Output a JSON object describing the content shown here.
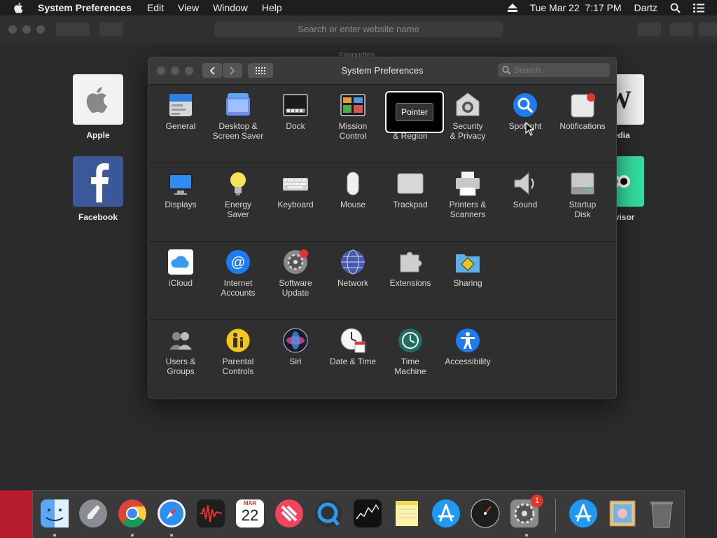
{
  "menubar": {
    "app_name": "System Preferences",
    "menus": [
      "Edit",
      "View",
      "Window",
      "Help"
    ],
    "datetime": "Tue Mar 22  7:17 PM",
    "user": "Dartz"
  },
  "safari": {
    "address_placeholder": "Search or enter website name",
    "faded_heading": "Favourites",
    "favourites": [
      {
        "label": "Apple"
      },
      {
        "label": "Facebook"
      },
      {
        "label": "pedia"
      },
      {
        "label": "Advisor"
      }
    ]
  },
  "prefs": {
    "title": "System Preferences",
    "search_placeholder": "Search",
    "sections": [
      [
        {
          "label": "General",
          "icon": "general-icon"
        },
        {
          "label": "Desktop &\nScreen Saver",
          "icon": "desktop-icon"
        },
        {
          "label": "Dock",
          "icon": "dock-icon"
        },
        {
          "label": "Mission\nControl",
          "icon": "mission-control-icon"
        },
        {
          "label": "Language\n& Region",
          "icon": "language-icon"
        },
        {
          "label": "Security\n& Privacy",
          "icon": "security-icon"
        },
        {
          "label": "Spotlight",
          "icon": "spotlight-icon"
        },
        {
          "label": "Notifications",
          "icon": "notifications-icon"
        }
      ],
      [
        {
          "label": "Displays",
          "icon": "displays-icon"
        },
        {
          "label": "Energy\nSaver",
          "icon": "energy-icon"
        },
        {
          "label": "Keyboard",
          "icon": "keyboard-icon"
        },
        {
          "label": "Mouse",
          "icon": "mouse-icon"
        },
        {
          "label": "Trackpad",
          "icon": "trackpad-icon"
        },
        {
          "label": "Printers &\nScanners",
          "icon": "printer-icon"
        },
        {
          "label": "Sound",
          "icon": "sound-icon"
        },
        {
          "label": "Startup\nDisk",
          "icon": "startup-disk-icon"
        }
      ],
      [
        {
          "label": "iCloud",
          "icon": "icloud-icon"
        },
        {
          "label": "Internet\nAccounts",
          "icon": "internet-accounts-icon"
        },
        {
          "label": "Software\nUpdate",
          "icon": "software-update-icon",
          "badge": "1"
        },
        {
          "label": "Network",
          "icon": "network-icon"
        },
        {
          "label": "Extensions",
          "icon": "extensions-icon"
        },
        {
          "label": "Sharing",
          "icon": "sharing-icon"
        }
      ],
      [
        {
          "label": "Users &\nGroups",
          "icon": "users-icon"
        },
        {
          "label": "Parental\nControls",
          "icon": "parental-icon"
        },
        {
          "label": "Siri",
          "icon": "siri-icon"
        },
        {
          "label": "Date & Time",
          "icon": "date-time-icon"
        },
        {
          "label": "Time\nMachine",
          "icon": "time-machine-icon"
        },
        {
          "label": "Accessibility",
          "icon": "accessibility-icon"
        }
      ]
    ]
  },
  "tooltip": {
    "text": "Pointer"
  },
  "dock": {
    "calendar_month": "MAR",
    "calendar_day": "22",
    "prefs_badge": "1",
    "items": [
      "Finder",
      "Launchpad",
      "Chrome",
      "Safari",
      "Voice Memos",
      "Calendar",
      "News",
      "QuickTime Player",
      "Stocks",
      "Notes",
      "App Store",
      "Activity Monitor",
      "System Preferences",
      "App Store",
      "Preview",
      "Trash"
    ]
  },
  "colors": {
    "window_bg": "#2f2f2f",
    "titlebar": "#3a3a3a",
    "accent_blue": "#1e7cf2",
    "badge_red": "#e5352b"
  }
}
